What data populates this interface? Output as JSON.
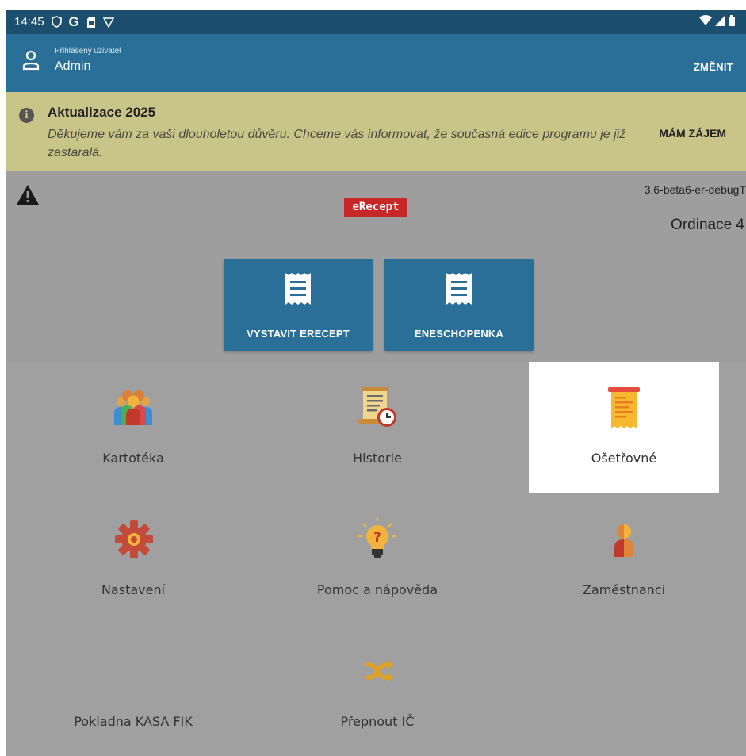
{
  "status_bar": {
    "time": "14:45",
    "icons": [
      "shield-icon",
      "google-icon",
      "sim-card-icon",
      "vpn-icon"
    ],
    "right_icons": [
      "wifi-icon",
      "signal-icon",
      "battery-icon"
    ]
  },
  "app_bar": {
    "user_caption": "Přihlášený uživatel",
    "user_name": "Admin",
    "change_label": "ZMĚNIT"
  },
  "banner": {
    "title": "Aktualizace 2025",
    "text": "Děkujeme vám za vaši dlouholetou důvěru. Chceme vás informovat, že současná edice programu je již zastaralá.",
    "action_label": "MÁM ZÁJEM"
  },
  "header": {
    "logo_text": "eRecept",
    "version": "3.6-beta6-er-debugT",
    "ordinace": "Ordinace 4"
  },
  "actions": [
    {
      "label": "VYSTAVIT ERECEPT",
      "icon": "receipt-icon"
    },
    {
      "label": "ENESCHOPENKA",
      "icon": "receipt-icon"
    }
  ],
  "menu": [
    {
      "label": "Kartotéka",
      "icon": "people-group-icon"
    },
    {
      "label": "Historie",
      "icon": "history-scroll-icon"
    },
    {
      "label": "Ošetřovné",
      "icon": "printed-receipt-icon",
      "selected": true
    },
    {
      "label": "Nastavení",
      "icon": "gear-icon"
    },
    {
      "label": "Pomoc a nápověda",
      "icon": "lightbulb-question-icon"
    },
    {
      "label": "Zaměstnanci",
      "icon": "person-icon"
    },
    {
      "label": "Pokladna KASA FIK",
      "icon": ""
    },
    {
      "label": "Přepnout IČ",
      "icon": "shuffle-icon"
    }
  ],
  "colors": {
    "status_bar": "#1c4f6e",
    "app_bar": "#2a6f97",
    "banner": "#c9c488",
    "background": "#9e9e9e",
    "logo": "#c62828"
  }
}
